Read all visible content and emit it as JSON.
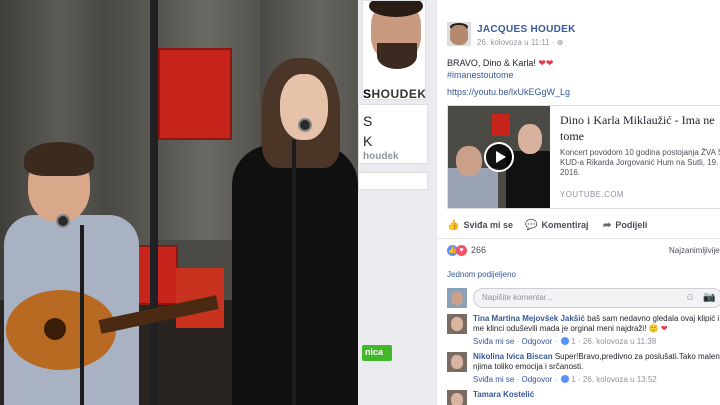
{
  "profile_strip": {
    "cover_name_prefix": "S",
    "cover_name_suffix": "HOUDEK",
    "card_line1": "S",
    "card_line2": "K",
    "card_handle": "houdek",
    "green_button": "nica"
  },
  "post": {
    "author": "JACQUES HOUDEK",
    "meta": "26. kolovoza u 11:11 · ⊕",
    "text": "BRAVO, Dino & Karla!",
    "hearts": "❤❤",
    "hashtag": "#imanestoutome",
    "link": "https://youtu.be/lxUkEGgW_Lg",
    "preview": {
      "title_line1": "Dino i Karla Miklaužić - Ima ne",
      "title_line2": "tome",
      "desc_line1": "Koncert povodom 10 godina postojanja ŽVA S",
      "desc_line2": "KUD-a Rikarda Jorgovanić Hum na Sutli, 19. s",
      "desc_line3": "2016.",
      "source": "YOUTUBE.COM"
    },
    "actions": {
      "like": "Sviđa mi se",
      "comment": "Komentiraj",
      "share": "Podijeli"
    },
    "reaction_count": "266",
    "sort_label": "Najzanimljivije",
    "shares_label": "Jednom podijeljeno",
    "composer_placeholder": "Napišite komentar...",
    "comments": [
      {
        "name": "Tina Martina Mejovšek Jakšić",
        "line1": " baš sam nedavno gledala ovaj klipić i",
        "line2": "me klinci oduševili mada je orginal meni najdraži!",
        "emoji": "🙂",
        "heart": "❤",
        "like": "Sviđa mi se",
        "reply": "Odgovor",
        "count": "1",
        "time": "26. kolovoza u 11:38"
      },
      {
        "name": "Nikolina Ivica Biscan",
        "line1": " Super!Bravo,predivno za poslušati.Tako maleni",
        "line2": "njima toliko emocija i srčanosti.",
        "like": "Sviđa mi se",
        "reply": "Odgovor",
        "count": "1",
        "time": "26. kolovoza u 13:52"
      },
      {
        "name": "Tamara Kostelić"
      }
    ]
  },
  "colors": {
    "link_blue": "#365899",
    "fb_bg": "#e9ebee",
    "like_blue": "#5890ff",
    "love_red": "#f25268",
    "green": "#42b72a"
  }
}
